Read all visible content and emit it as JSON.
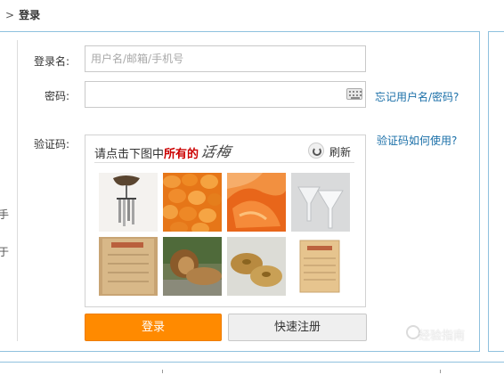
{
  "breadcrumb": {
    "arrow": ">",
    "current": "登录"
  },
  "side_fragments": [
    "手",
    "于"
  ],
  "form": {
    "username_label": "登录名:",
    "username_placeholder": "用户名/邮箱/手机号",
    "username_value": "",
    "password_label": "密码:",
    "password_value": "",
    "forgot_link": "忘记用户名/密码?",
    "captcha_label": "验证码:",
    "captcha_help_link": "验证码如何使用?"
  },
  "captcha": {
    "instruction_prefix": "请点击下图中",
    "instruction_highlight": "所有的",
    "target_word": "话梅",
    "refresh_label": "刷新",
    "tiles": [
      "wind-chime",
      "dried-apricots",
      "dried-mango",
      "glass-funnels",
      "document-paper",
      "lion",
      "cymbals",
      "document-paper"
    ]
  },
  "buttons": {
    "login": "登录",
    "register": "快速注册"
  },
  "watermark": "经验指南",
  "colors": {
    "panel_border": "#8fc1de",
    "login_button": "#ff8a00",
    "link": "#1a6fa8",
    "highlight": "#cc0000"
  }
}
